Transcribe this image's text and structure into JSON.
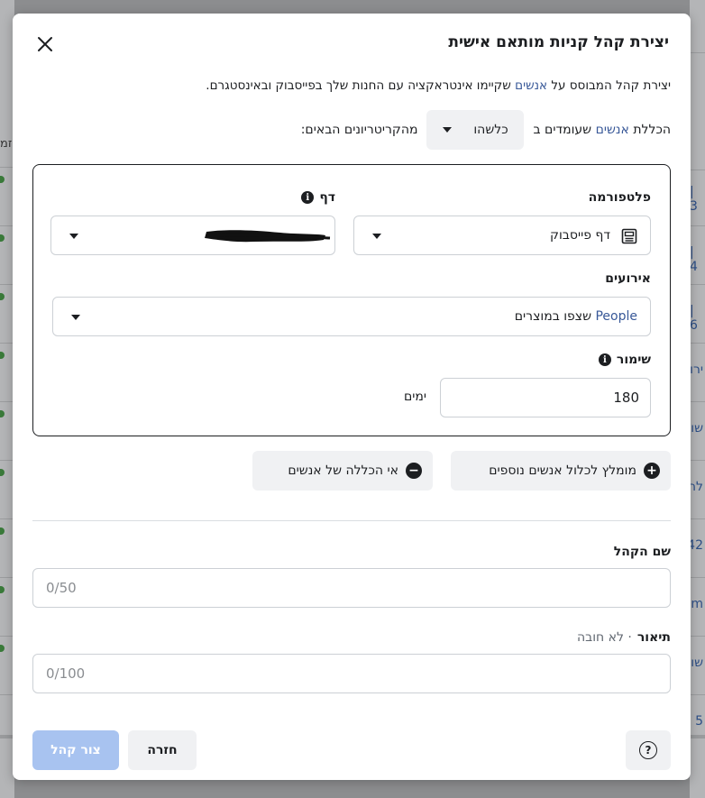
{
  "dialog": {
    "title": "יצירת קהל קניות מותאם אישית",
    "subtitle": {
      "prefix": "יצירת קהל המבוסס על ",
      "link": "אנשים",
      "suffix": " שקיימו אינטראקציה עם החנות שלך בפייסבוק ובאינסטגרם."
    },
    "include_row": {
      "prefix": "הכללת ",
      "link": "אנשים",
      "middle": " שעומדים ב",
      "selector_value": "כלשהו",
      "suffix": "מהקריטריונים הבאים:"
    }
  },
  "criteria": {
    "platform_label": "פלטפורמה",
    "platform_value": "דף פייסבוק",
    "page_label": "דף",
    "events_label": "אירועים",
    "events_value_link": "People",
    "events_value_text": " שצפו במוצרים",
    "retention_label": "שימור",
    "retention_value": "180",
    "retention_unit": "ימים"
  },
  "actions": {
    "include_more": "מומלץ לכלול אנשים נוספים",
    "exclude": "אי הכללה של אנשים"
  },
  "form": {
    "name_label": "שם הקהל",
    "name_placeholder": "0/50",
    "desc_label": "תיאור",
    "desc_optional": " · לא חובה",
    "desc_placeholder": "0/100"
  },
  "footer": {
    "create": "צור קהל",
    "back": "חזרה",
    "help": "?"
  },
  "background": {
    "right_fragments": [
      "| 3",
      "| 4",
      "| 6",
      "ירו",
      "שוו",
      "לה",
      "42",
      "am",
      "שו",
      "5"
    ],
    "left_fragment": "זמ"
  }
}
